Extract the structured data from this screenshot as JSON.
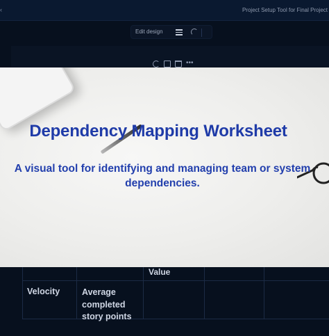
{
  "topbar": {
    "doc_title": "Project Setup Tool for Final Project"
  },
  "toolbar": {
    "edit_design_label": "Edit design"
  },
  "slide": {
    "title": "Dependency Mapping Worksheet",
    "subtitle": "A visual tool for identifying and managing team or system dependencies.",
    "title_color": "#1f3ba8"
  },
  "table": {
    "partial_header": "Value",
    "rows": [
      {
        "metric": "Velocity",
        "description": "Average completed story points"
      }
    ]
  },
  "icons": [
    "menu-icon",
    "spinner-icon",
    "refresh-icon",
    "copy-icon",
    "trash-icon",
    "more-icon"
  ]
}
